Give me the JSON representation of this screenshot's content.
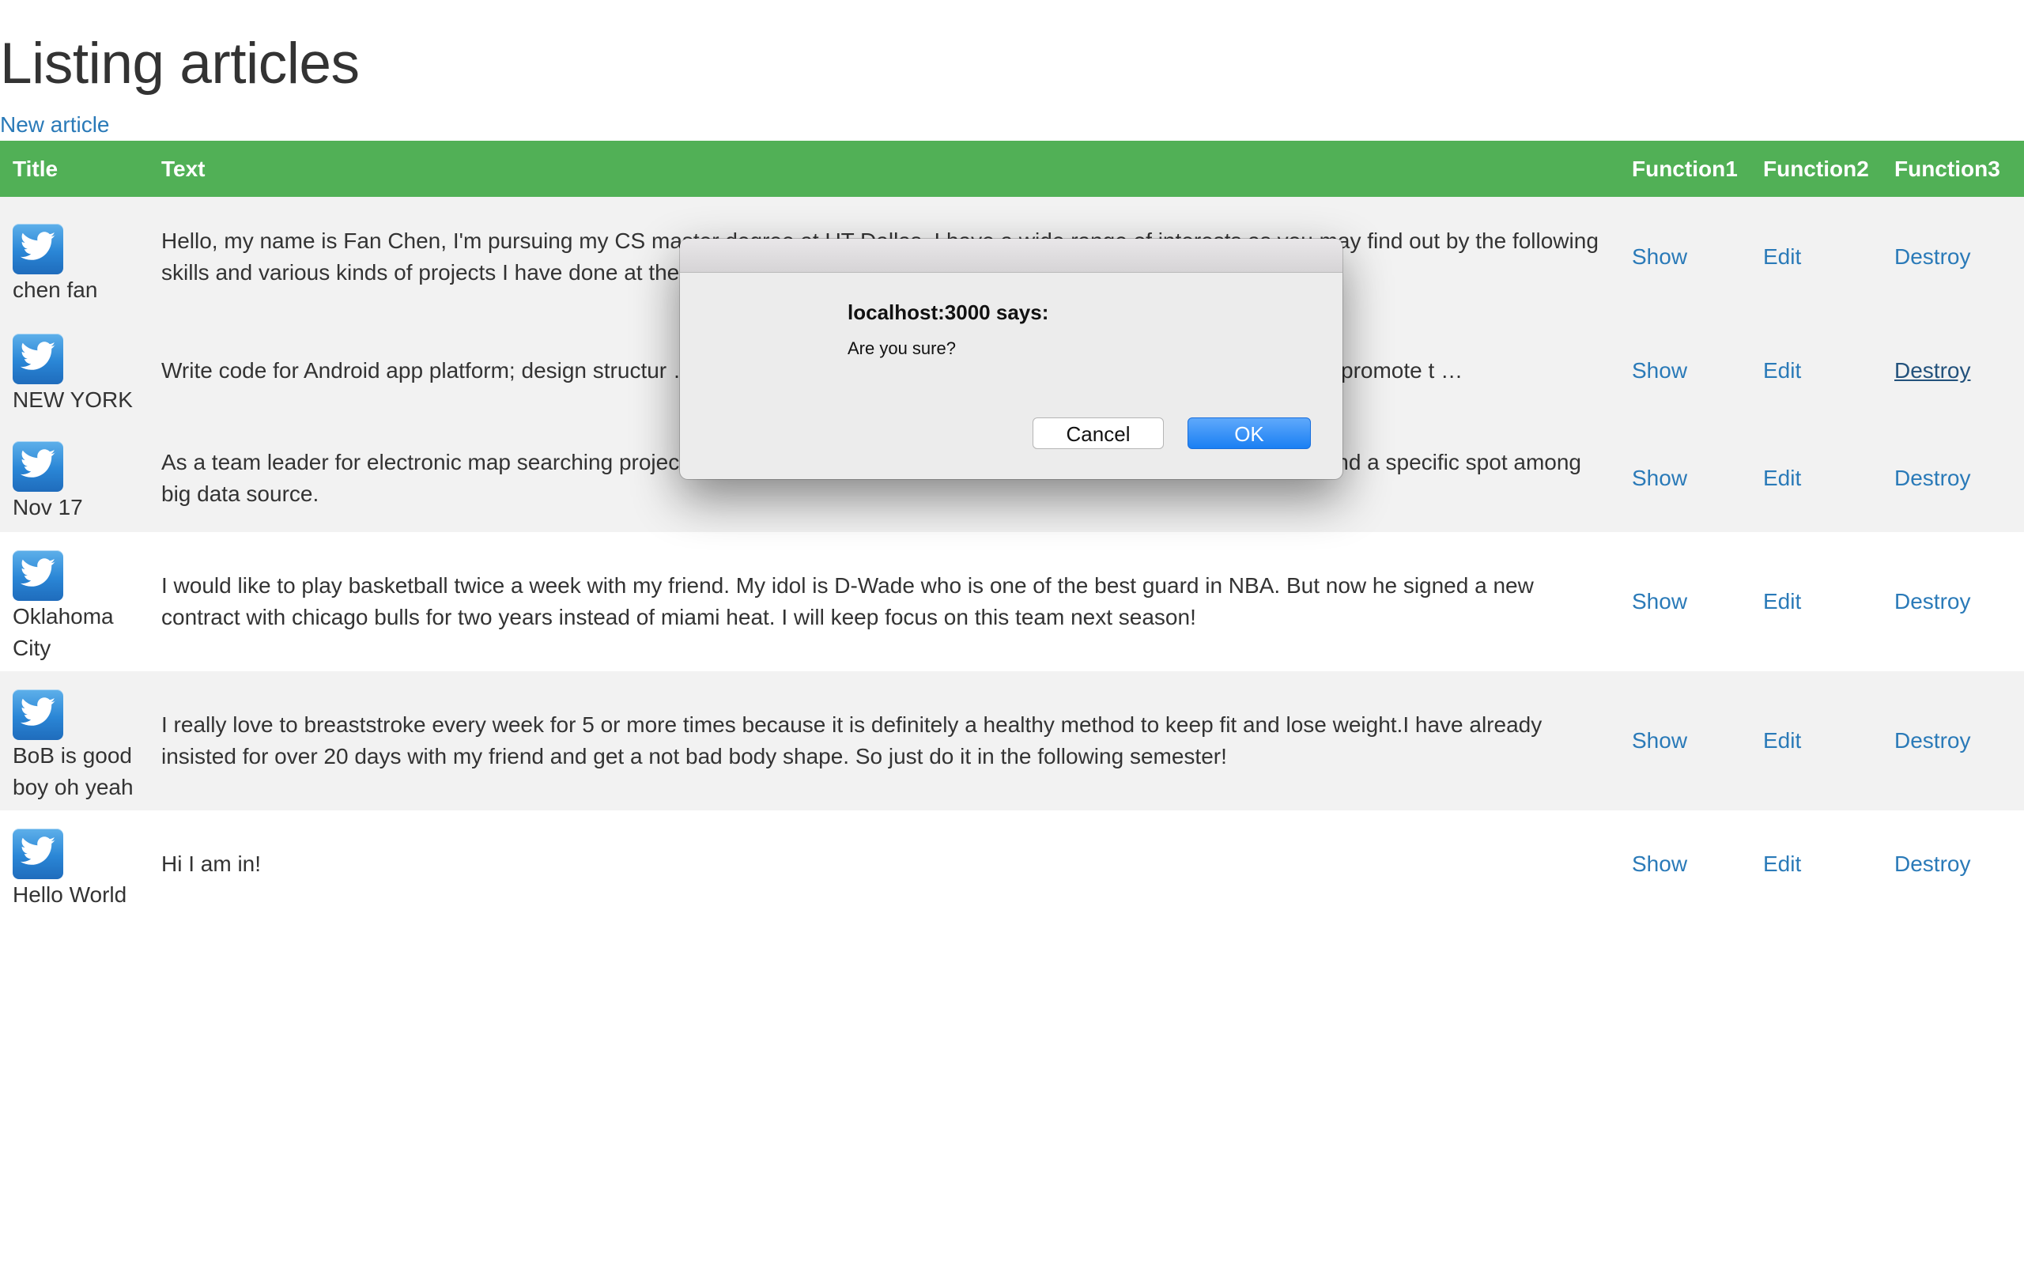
{
  "page": {
    "heading": "Listing articles",
    "new_link": "New article"
  },
  "table": {
    "headers": [
      "Title",
      "Text",
      "Function1",
      "Function2",
      "Function3"
    ],
    "rows": [
      {
        "title": "chen fan",
        "text": "Hello, my name is Fan Chen, I'm pursuing my CS master degree at UT Dallas.  I have a wide range of interests as you may find out by the following skills and various kinds of projects I have done at the … r relevant things and my daily life.",
        "show": "Show",
        "edit": "Edit",
        "destroy": "Destroy"
      },
      {
        "title": "NEW YORK",
        "text": "Write code for Android app platform; design structur … ng to the timeline and quality requirements; assist the superior to promote t …",
        "show": "Show",
        "edit": "Edit",
        "destroy": "Destroy"
      },
      {
        "title": "Nov 17",
        "text": "As a team leader for electronic map searching projec … d do the program. Using several adverse sorting algorithms to find a specific spot among big data source.",
        "show": "Show",
        "edit": "Edit",
        "destroy": "Destroy"
      },
      {
        "title": "Oklahoma City",
        "text": "I would like to play basketball twice a week with my friend. My idol is D-Wade who is one of the best guard in NBA. But now he signed a new contract with chicago bulls for two years instead of miami heat. I will keep focus on this team next season!",
        "show": "Show",
        "edit": "Edit",
        "destroy": "Destroy"
      },
      {
        "title": "BoB is good boy oh yeah",
        "text": "I really love to breaststroke every week for 5 or more times because it is definitely a healthy method to keep fit and lose weight.I have already insisted for over 20 days with my friend and get a not bad body shape. So just do it in the following semester!",
        "show": "Show",
        "edit": "Edit",
        "destroy": "Destroy"
      },
      {
        "title": "Hello World",
        "text": "Hi I am in!",
        "show": "Show",
        "edit": "Edit",
        "destroy": "Destroy"
      }
    ]
  },
  "dialog": {
    "title": "localhost:3000 says:",
    "message": "Are you sure?",
    "cancel_label": "Cancel",
    "ok_label": "OK"
  },
  "colors": {
    "header_bg": "#51b056",
    "link": "#2a7ab8",
    "ok_button": "#1a7ff3"
  },
  "icons": {
    "row_avatar": "twitter-bird-icon"
  }
}
